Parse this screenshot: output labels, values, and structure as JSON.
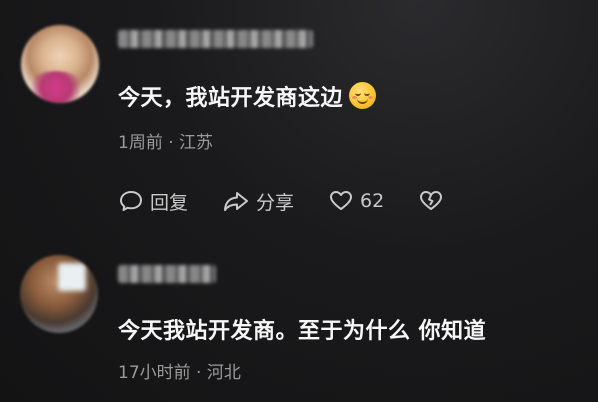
{
  "comments": [
    {
      "text": "今天，我站开发商这边",
      "emoji": "relieved-smile-emoji",
      "meta": "1周前 · 江苏",
      "actions": {
        "reply": "回复",
        "share": "分享",
        "like_count": "62"
      }
    },
    {
      "text": "今天我站开发商。至于为什么 你知道",
      "meta": "17小时前 · 河北"
    }
  ],
  "colors": {
    "background": "#1a1a1c",
    "text": "#f6f6f6",
    "meta": "#9a9a9a",
    "icon": "#c9c9c9"
  }
}
